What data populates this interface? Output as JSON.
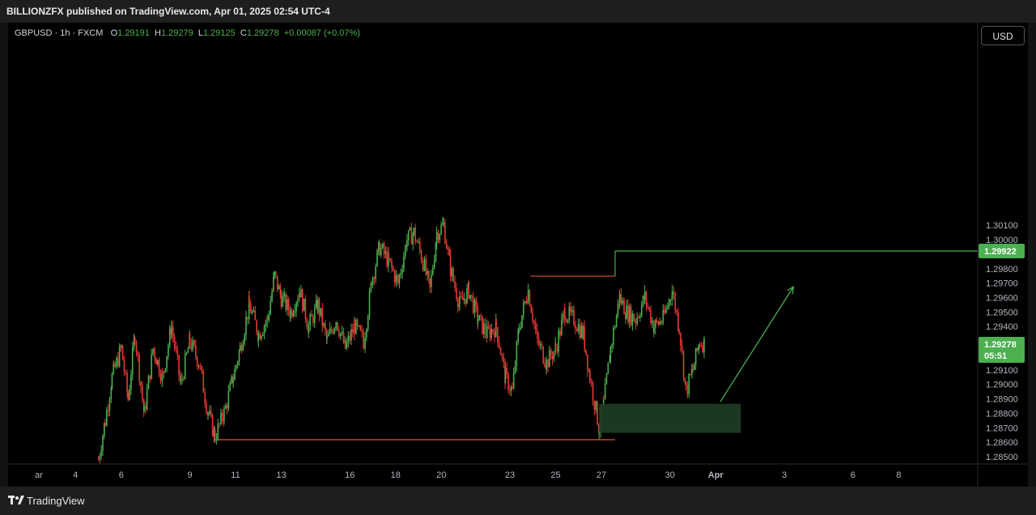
{
  "header": {
    "title": "BILLIONZFX published on TradingView.com, Apr 01, 2025 02:54 UTC-4"
  },
  "legend": {
    "symbol": "GBPUSD · 1h · FXCM",
    "o_label": "O",
    "o_value": "1.29191",
    "h_label": "H",
    "h_value": "1.29279",
    "l_label": "L",
    "l_value": "1.29125",
    "c_label": "C",
    "c_value": "1.29278",
    "change": "+0.00087 (+0.07%)"
  },
  "currency_button": "USD",
  "footer": {
    "brand": "TradingView"
  },
  "colors": {
    "up": "#4caf50",
    "down": "#e53935",
    "level_line": "#e0533f",
    "target_line": "#4caf50",
    "demand_zone": "#1d3b22",
    "price_tag": "#4caf50"
  },
  "chart_data": {
    "type": "candlestick",
    "symbol": "GBPUSD",
    "timeframe": "1h",
    "ylim": [
      1.2845,
      1.315
    ],
    "y_ticks": [
      "1.28500",
      "1.28600",
      "1.28700",
      "1.28800",
      "1.28900",
      "1.29000",
      "1.29100",
      "1.29200",
      "1.29300",
      "1.29400",
      "1.29500",
      "1.29600",
      "1.29700",
      "1.29800",
      "1.29900",
      "1.30000",
      "1.30100"
    ],
    "x_ticks": [
      "ar",
      "4",
      "6",
      "9",
      "11",
      "13",
      "16",
      "18",
      "20",
      "23",
      "25",
      "27",
      "30",
      "Apr",
      "3",
      "6",
      "8"
    ],
    "current_price": "1.29278",
    "countdown": "05:51",
    "target_price": "1.29922",
    "price_path": [
      {
        "d": 5.0,
        "p": 1.2848
      },
      {
        "d": 5.3,
        "p": 1.2875
      },
      {
        "d": 5.6,
        "p": 1.2905
      },
      {
        "d": 6.0,
        "p": 1.2925
      },
      {
        "d": 6.3,
        "p": 1.289
      },
      {
        "d": 6.6,
        "p": 1.2935
      },
      {
        "d": 7.0,
        "p": 1.288
      },
      {
        "d": 7.4,
        "p": 1.2925
      },
      {
        "d": 7.8,
        "p": 1.2905
      },
      {
        "d": 8.2,
        "p": 1.294
      },
      {
        "d": 8.6,
        "p": 1.29
      },
      {
        "d": 9.0,
        "p": 1.293
      },
      {
        "d": 9.4,
        "p": 1.2915
      },
      {
        "d": 9.8,
        "p": 1.288
      },
      {
        "d": 10.1,
        "p": 1.2864
      },
      {
        "d": 10.5,
        "p": 1.288
      },
      {
        "d": 10.9,
        "p": 1.2905
      },
      {
        "d": 11.2,
        "p": 1.2925
      },
      {
        "d": 11.6,
        "p": 1.2955
      },
      {
        "d": 12.0,
        "p": 1.2935
      },
      {
        "d": 12.4,
        "p": 1.2945
      },
      {
        "d": 12.7,
        "p": 1.2975
      },
      {
        "d": 13.0,
        "p": 1.296
      },
      {
        "d": 13.4,
        "p": 1.295
      },
      {
        "d": 13.8,
        "p": 1.2965
      },
      {
        "d": 14.2,
        "p": 1.294
      },
      {
        "d": 14.6,
        "p": 1.2955
      },
      {
        "d": 15.0,
        "p": 1.293
      },
      {
        "d": 15.4,
        "p": 1.2945
      },
      {
        "d": 15.8,
        "p": 1.2925
      },
      {
        "d": 16.2,
        "p": 1.294
      },
      {
        "d": 16.6,
        "p": 1.293
      },
      {
        "d": 17.0,
        "p": 1.2975
      },
      {
        "d": 17.3,
        "p": 1.2995
      },
      {
        "d": 17.7,
        "p": 1.2985
      },
      {
        "d": 18.1,
        "p": 1.297
      },
      {
        "d": 18.5,
        "p": 1.3
      },
      {
        "d": 18.8,
        "p": 1.3005
      },
      {
        "d": 19.2,
        "p": 1.2985
      },
      {
        "d": 19.5,
        "p": 1.2965
      },
      {
        "d": 19.8,
        "p": 1.3005
      },
      {
        "d": 20.1,
        "p": 1.301
      },
      {
        "d": 20.4,
        "p": 1.298
      },
      {
        "d": 20.8,
        "p": 1.2955
      },
      {
        "d": 21.2,
        "p": 1.2965
      },
      {
        "d": 21.6,
        "p": 1.2945
      },
      {
        "d": 22.0,
        "p": 1.2935
      },
      {
        "d": 22.4,
        "p": 1.294
      },
      {
        "d": 22.8,
        "p": 1.2905
      },
      {
        "d": 23.1,
        "p": 1.2895
      },
      {
        "d": 23.4,
        "p": 1.294
      },
      {
        "d": 23.8,
        "p": 1.2965
      },
      {
        "d": 24.2,
        "p": 1.293
      },
      {
        "d": 24.6,
        "p": 1.2915
      },
      {
        "d": 25.0,
        "p": 1.2925
      },
      {
        "d": 25.4,
        "p": 1.295
      },
      {
        "d": 25.8,
        "p": 1.2945
      },
      {
        "d": 26.2,
        "p": 1.2935
      },
      {
        "d": 26.5,
        "p": 1.2905
      },
      {
        "d": 26.9,
        "p": 1.287
      },
      {
        "d": 27.1,
        "p": 1.2886
      },
      {
        "d": 27.4,
        "p": 1.2925
      },
      {
        "d": 27.8,
        "p": 1.296
      },
      {
        "d": 28.1,
        "p": 1.295
      },
      {
        "d": 28.5,
        "p": 1.2945
      },
      {
        "d": 28.9,
        "p": 1.296
      },
      {
        "d": 29.3,
        "p": 1.294
      },
      {
        "d": 29.7,
        "p": 1.2945
      },
      {
        "d": 30.1,
        "p": 1.2965
      },
      {
        "d": 30.4,
        "p": 1.294
      },
      {
        "d": 30.7,
        "p": 1.2895
      },
      {
        "d": 31.0,
        "p": 1.291
      },
      {
        "d": 31.3,
        "p": 1.293
      },
      {
        "d": 31.5,
        "p": 1.2928
      }
    ],
    "annotations": {
      "support_line": {
        "price": 1.28618,
        "from": 10.2,
        "to": 27.6
      },
      "resistance_line": {
        "price": 1.29748,
        "from": 23.9,
        "to": 27.6
      },
      "target_line": {
        "price": 1.29922,
        "from": 27.6
      },
      "demand_zone": {
        "price_top": 1.28866,
        "price_bottom": 1.28665,
        "from": 26.9,
        "to": 33.1
      },
      "projection_arrow": {
        "from": {
          "d": 32.2,
          "p": 1.2888
        },
        "to": {
          "d": 35.4,
          "p": 1.29675
        }
      }
    }
  }
}
